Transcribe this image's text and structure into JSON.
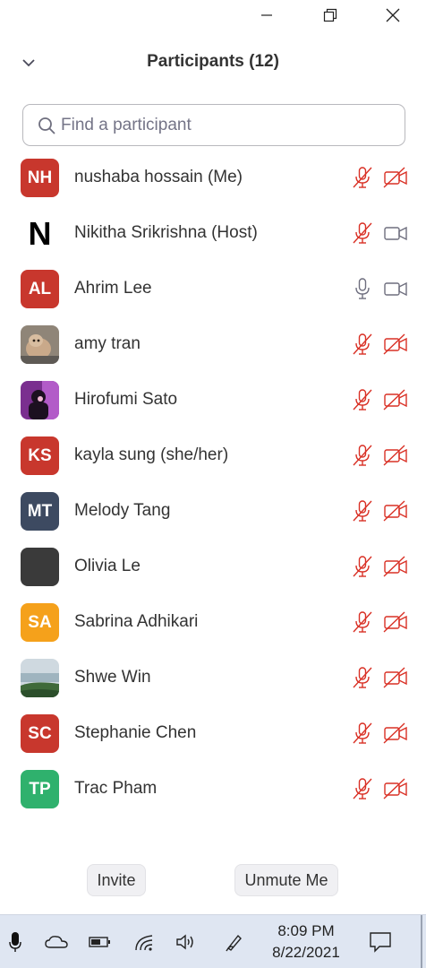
{
  "header": {
    "title": "Participants (12)"
  },
  "search": {
    "placeholder": "Find a participant"
  },
  "colors": {
    "muted_red": "#d93025",
    "icon_gray": "#6e6e7e",
    "red_avatar": "#c8372d",
    "navy_avatar": "#3d4a61",
    "orange_avatar": "#f5a11b",
    "green_avatar": "#2fb16d"
  },
  "participants": [
    {
      "name": "nushaba hossain (Me)",
      "initials": "NH",
      "avatar": "initials",
      "avatar_color": "#c8372d",
      "mic": "muted",
      "video": "off"
    },
    {
      "name": "Nikitha Srikrishna (Host)",
      "initials": "N",
      "avatar": "letter",
      "avatar_color": "",
      "mic": "muted",
      "video": "on"
    },
    {
      "name": "Ahrim Lee",
      "initials": "AL",
      "avatar": "initials",
      "avatar_color": "#c8372d",
      "mic": "on",
      "video": "on"
    },
    {
      "name": "amy tran",
      "initials": "",
      "avatar": "photo-dog",
      "avatar_color": "",
      "mic": "muted",
      "video": "off"
    },
    {
      "name": "Hirofumi Sato",
      "initials": "",
      "avatar": "photo-purple",
      "avatar_color": "",
      "mic": "muted",
      "video": "off"
    },
    {
      "name": "kayla sung (she/her)",
      "initials": "KS",
      "avatar": "initials",
      "avatar_color": "#c8372d",
      "mic": "muted",
      "video": "off"
    },
    {
      "name": "Melody Tang",
      "initials": "MT",
      "avatar": "initials",
      "avatar_color": "#3d4a61",
      "mic": "muted",
      "video": "off"
    },
    {
      "name": "Olivia Le",
      "initials": "",
      "avatar": "photo-dark",
      "avatar_color": "",
      "mic": "muted",
      "video": "off"
    },
    {
      "name": "Sabrina Adhikari",
      "initials": "SA",
      "avatar": "initials",
      "avatar_color": "#f5a11b",
      "mic": "muted",
      "video": "off"
    },
    {
      "name": "Shwe Win",
      "initials": "",
      "avatar": "photo-landscape",
      "avatar_color": "",
      "mic": "muted",
      "video": "off"
    },
    {
      "name": "Stephanie Chen",
      "initials": "SC",
      "avatar": "initials",
      "avatar_color": "#c8372d",
      "mic": "muted",
      "video": "off"
    },
    {
      "name": "Trac Pham",
      "initials": "TP",
      "avatar": "initials",
      "avatar_color": "#2fb16d",
      "mic": "muted",
      "video": "off"
    }
  ],
  "footer": {
    "invite_label": "Invite",
    "unmute_label": "Unmute Me"
  },
  "taskbar": {
    "time": "8:09 PM",
    "date": "8/22/2021",
    "icons": [
      "microphone-icon",
      "onedrive-cloud-icon",
      "battery-icon",
      "wifi-icon",
      "volume-icon",
      "pen-icon",
      "notification-icon"
    ]
  }
}
